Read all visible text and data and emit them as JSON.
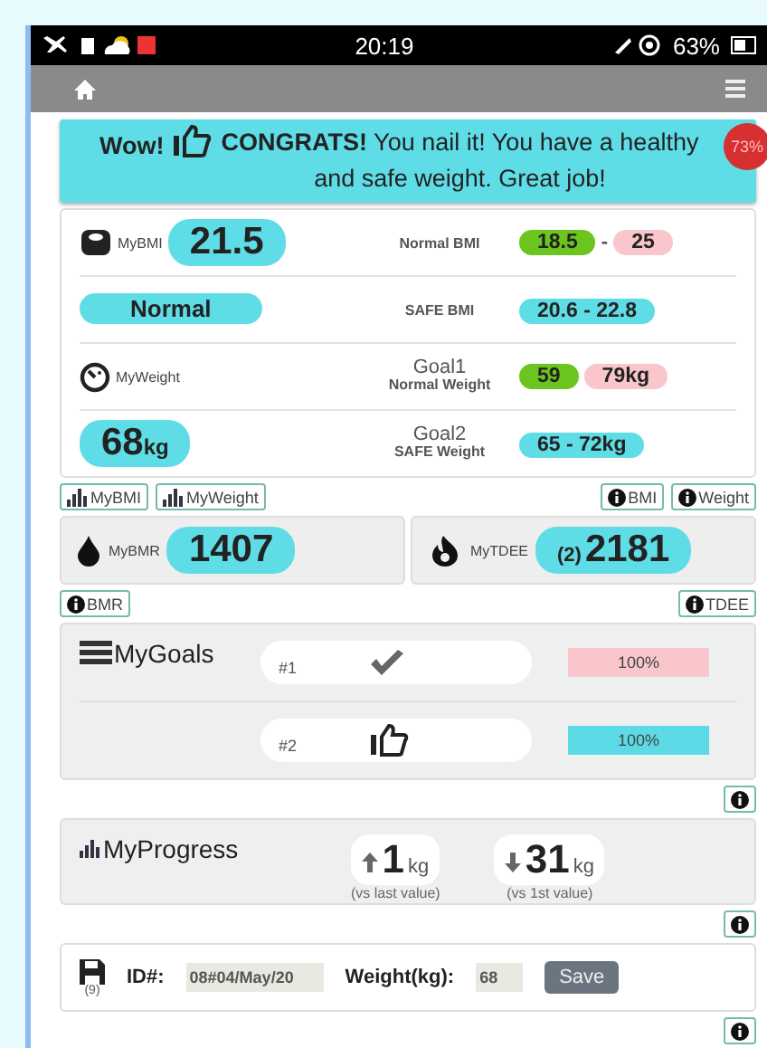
{
  "status_bar": {
    "time": "20:19",
    "battery": "63%"
  },
  "banner": {
    "lead": "Wow!",
    "message": "**CONGRATS!** You nail it! You have a healthy and safe weight. Great job!",
    "badge": "73%"
  },
  "bmi": {
    "label": "MyBMI",
    "value": "21.5",
    "range_label": "Normal BMI",
    "range_low": "18.5",
    "range_sep": "-",
    "range_high": "25"
  },
  "bmi_status": {
    "value": "Normal",
    "range_label": "SAFE BMI",
    "range": "20.6 - 22.8"
  },
  "weight": {
    "label": "MyWeight",
    "goal_title": "Goal1",
    "goal_subtitle": "Normal Weight",
    "range_low": "59",
    "range_high": "79kg"
  },
  "weight_value": {
    "value": "68",
    "unit": "kg",
    "goal_title": "Goal2",
    "goal_subtitle": "SAFE Weight",
    "range": "65 - 72kg"
  },
  "chart_buttons": [
    "MyBMI",
    "MyWeight"
  ],
  "info_buttons": [
    "BMI",
    "Weight"
  ],
  "energy": [
    {
      "kind": "drop",
      "label": "MyBMR",
      "value": "1407",
      "info": "BMR"
    },
    {
      "kind": "flame",
      "label": "MyTDEE",
      "note": "(2)",
      "value": "2181",
      "info": "TDEE"
    }
  ],
  "goals": {
    "title": "MyGoals",
    "items": [
      {
        "number": "#1",
        "kind": "check",
        "reading": "100%",
        "level": 1,
        "color": "#f8c6cb"
      },
      {
        "number": "#2",
        "kind": "thumb",
        "reading": "100%",
        "level": 1,
        "color": "#5cdbe6"
      }
    ]
  },
  "progress": {
    "title": "MyProgress",
    "items": [
      {
        "kind": "up",
        "value": "1",
        "unit": "kg",
        "note": "(vs last value)"
      },
      {
        "kind": "down",
        "value": "31",
        "unit": "kg",
        "note": "(vs 1st value)"
      }
    ]
  },
  "entry": {
    "count": "(9)",
    "id_label": "ID#:",
    "id_value": "08#04/May/20",
    "weight_label": "Weight(kg):",
    "weight_value": "68",
    "save": "Save"
  }
}
